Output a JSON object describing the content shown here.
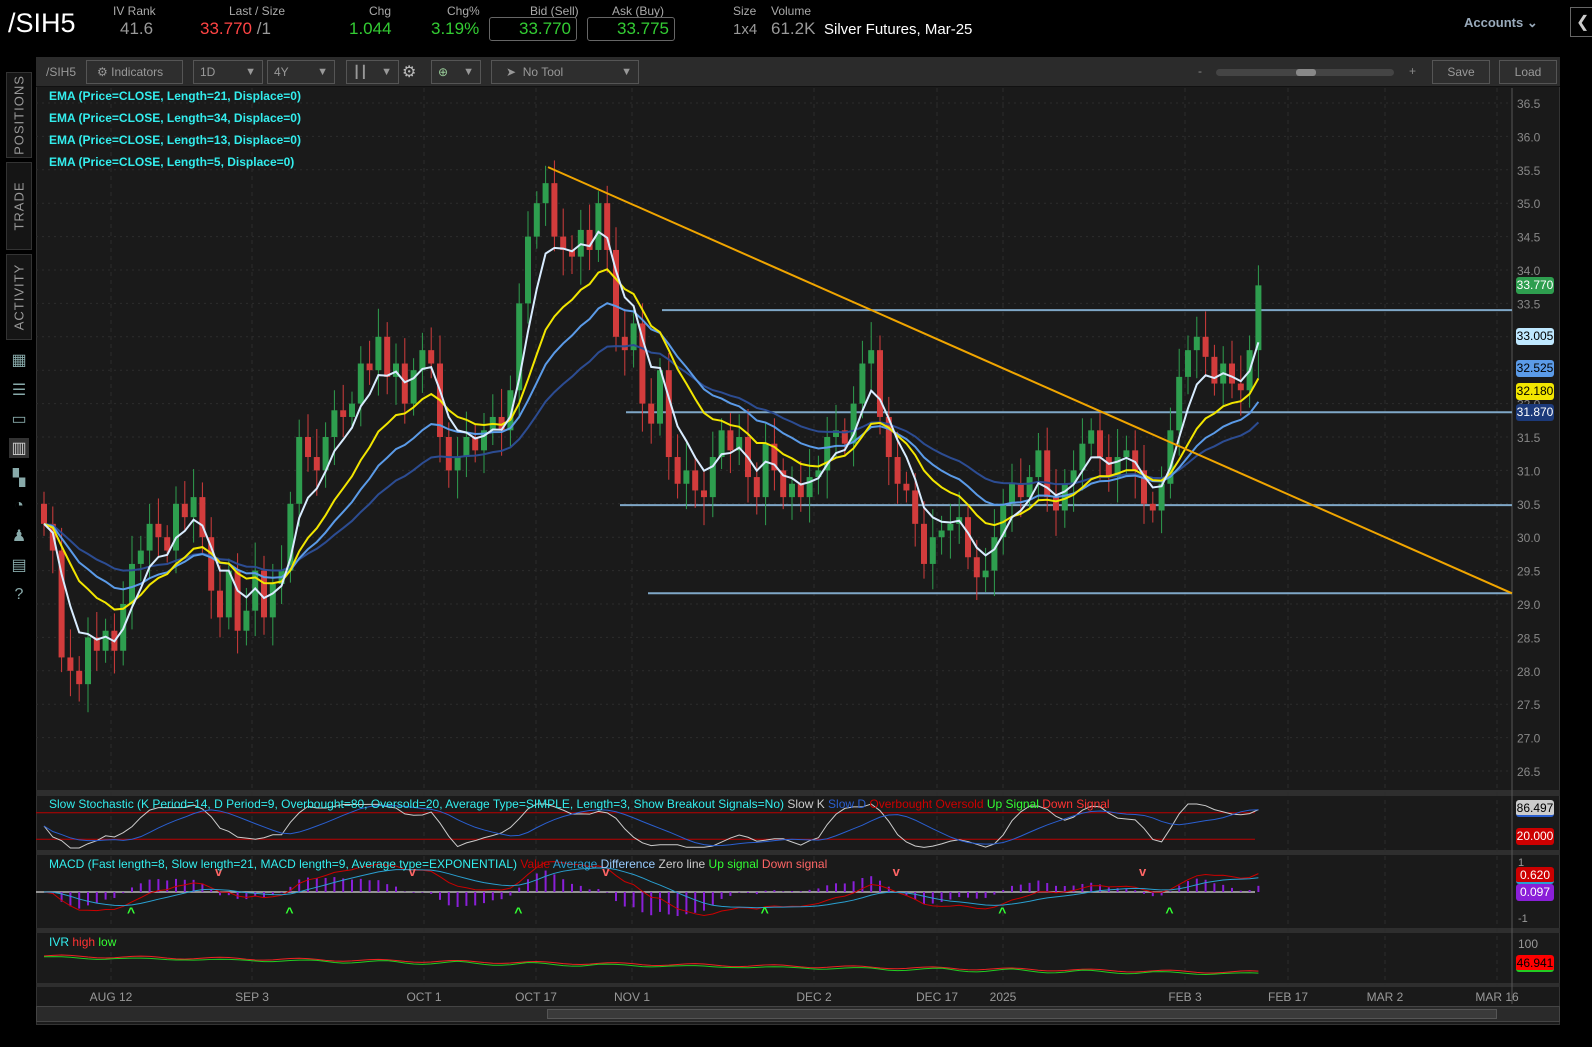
{
  "header": {
    "symbol": "/SIH5",
    "iv_rank_label": "IV Rank",
    "iv_rank": "41.6",
    "last_label": "Last / Size",
    "last": "33.770",
    "size": "/1",
    "chg_label": "Chg",
    "chg": "1.044",
    "chgpct_label": "Chg%",
    "chgpct": "3.19%",
    "bid_label": "Bid (Sell)",
    "bid": "33.770",
    "ask_label": "Ask (Buy)",
    "ask": "33.775",
    "size_label": "Size",
    "size_val": "1x4",
    "volume_label": "Volume",
    "volume": "61.2K",
    "description": "Silver Futures, Mar-25",
    "accounts": "Accounts"
  },
  "sidebar": {
    "tabs": [
      "POSITIONS",
      "TRADE",
      "ACTIVITY"
    ],
    "icons": [
      "calculator-icon",
      "list-icon",
      "tv-icon",
      "chart-icon",
      "grid-icon",
      "speedometer-icon",
      "people-icon",
      "calendar-icon",
      "help-icon"
    ]
  },
  "toolbar": {
    "symbol": "/SIH5",
    "indicators": "Indicators",
    "aggregation": "1D",
    "timeframe": "4Y",
    "tool": "No Tool",
    "zoom_minus": "-",
    "zoom_plus": "+",
    "save": "Save",
    "load": "Load"
  },
  "studies": [
    "EMA (Price=CLOSE, Length=21, Displace=0)",
    "EMA (Price=CLOSE, Length=34, Displace=0)",
    "EMA (Price=CLOSE, Length=13, Displace=0)",
    "EMA (Price=CLOSE, Length=5, Displace=0)"
  ],
  "colors": {
    "up": "#2e9e4f",
    "down": "#d23c3c",
    "ema5": "#d8ecff",
    "ema13": "#f2e600",
    "ema21": "#5b9be8",
    "ema34": "#2c4c92",
    "trendline": "#f0a500",
    "level": "#7fa7c7"
  },
  "chart_data": {
    "type": "candlestick",
    "yrange": [
      26.5,
      36.5
    ],
    "closes": [
      30.2,
      29.8,
      28.2,
      28.0,
      27.8,
      28.5,
      28.3,
      28.6,
      28.3,
      29.0,
      29.6,
      29.8,
      30.2,
      30.0,
      29.8,
      30.5,
      30.3,
      30.6,
      30.0,
      29.2,
      28.8,
      29.5,
      28.6,
      28.9,
      29.5,
      28.8,
      29.3,
      29.5,
      30.5,
      31.5,
      31.2,
      31.0,
      31.5,
      31.9,
      31.8,
      32.0,
      32.6,
      32.5,
      33.0,
      32.4,
      32.6,
      32.0,
      32.5,
      32.8,
      32.6,
      31.5,
      31.0,
      31.2,
      31.5,
      31.3,
      31.6,
      31.8,
      31.6,
      32.2,
      33.5,
      34.5,
      35.0,
      35.3,
      34.5,
      34.3,
      34.2,
      34.6,
      34.3,
      35.0,
      34.3,
      33.0,
      32.8,
      33.2,
      32.0,
      31.7,
      32.5,
      31.2,
      30.8,
      31.0,
      30.7,
      30.6,
      31.2,
      31.6,
      31.3,
      31.5,
      30.9,
      30.6,
      31.4,
      31.0,
      30.6,
      30.8,
      30.6,
      30.9,
      31.0,
      31.5,
      31.6,
      31.4,
      32.0,
      32.6,
      32.8,
      31.8,
      31.2,
      30.8,
      30.7,
      30.2,
      29.6,
      30.0,
      30.1,
      30.2,
      30.3,
      29.7,
      29.4,
      29.5,
      30.0,
      30.5,
      30.8,
      30.6,
      30.9,
      31.3,
      30.6,
      30.4,
      30.8,
      31.0,
      31.4,
      31.6,
      31.2,
      30.9,
      31.2,
      31.3,
      31.0,
      30.5,
      30.4,
      30.8,
      31.6,
      32.4,
      32.8,
      33.0,
      32.7,
      32.3,
      32.6,
      32.3,
      32.2,
      32.8,
      33.77
    ],
    "levels": [
      33.4,
      31.87,
      30.48,
      29.16
    ],
    "trendline": {
      "from": 35.54,
      "to": 29.16
    },
    "x_ticks": [
      "AUG 12",
      "SEP 3",
      "OCT 1",
      "OCT 17",
      "NOV 1",
      "DEC 2",
      "DEC 17",
      "2025",
      "FEB 3",
      "FEB 17",
      "MAR 2",
      "MAR 16"
    ],
    "price_tags": {
      "last": "33.770",
      "ema5": "33.005",
      "ema21": "32.525",
      "ema13": "32.180",
      "ema34": "31.870"
    }
  },
  "stochastic": {
    "title": "Slow Stochastic (K Period=14, D Period=9, Overbought=80, Oversold=20, Average Type=SIMPLE, Length=3, Show Breakout Signals=No)",
    "legend": [
      "Slow K",
      "Slow D",
      "Overbought",
      "Oversold",
      "Up Signal",
      "Down Signal"
    ],
    "value": "86.497",
    "oversold": "20.000"
  },
  "macd": {
    "title": "MACD (Fast length=8, Slow length=21, MACD length=9, Average type=EXPONENTIAL)",
    "legend": [
      "Value",
      "Average",
      "Difference",
      "Zero line",
      "Up signal",
      "Down signal"
    ],
    "top": "1",
    "bottom": "-1",
    "value": "0.620",
    "diff": "0.097"
  },
  "ivr": {
    "title": "IVR",
    "legend": [
      "high",
      "low"
    ],
    "top": "100",
    "value": "46.941"
  }
}
